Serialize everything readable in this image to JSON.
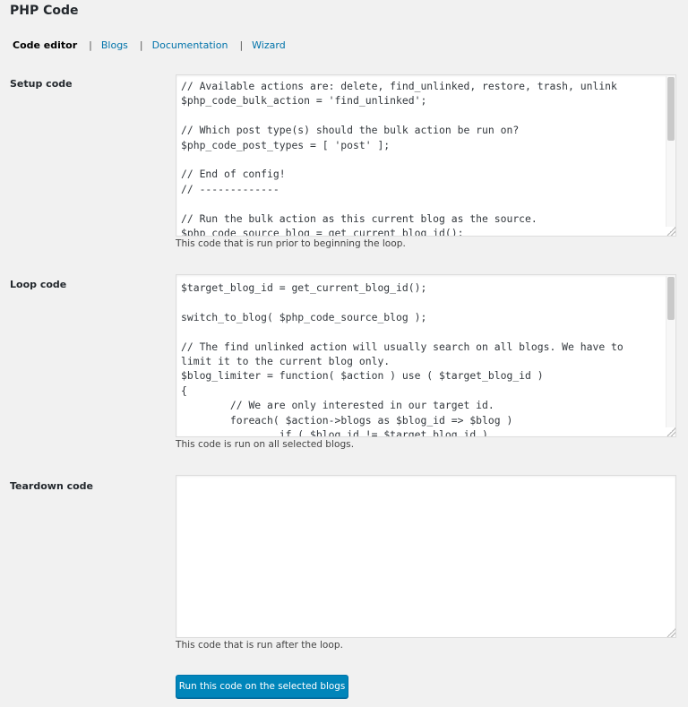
{
  "page": {
    "title": "PHP Code"
  },
  "subnav": {
    "items": [
      {
        "label": "Code editor"
      },
      {
        "label": "Blogs"
      },
      {
        "label": "Documentation"
      },
      {
        "label": "Wizard"
      }
    ],
    "separator": "|"
  },
  "setup": {
    "label": "Setup code",
    "code": "// Available actions are: delete, find_unlinked, restore, trash, unlink\n$php_code_bulk_action = 'find_unlinked';\n\n// Which post type(s) should the bulk action be run on?\n$php_code_post_types = [ 'post' ];\n\n// End of config!\n// -------------\n\n// Run the bulk action as this current blog as the source.\n$php_code_source_blog = get_current_blog_id();",
    "description": "This code that is run prior to beginning the loop."
  },
  "loop": {
    "label": "Loop code",
    "code": "$target_blog_id = get_current_blog_id();\n\nswitch_to_blog( $php_code_source_blog );\n\n// The find unlinked action will usually search on all blogs. We have to limit it to the current blog only.\n$blog_limiter = function( $action ) use ( $target_blog_id )\n{\n        // We are only interested in our target id.\n        foreach( $action->blogs as $blog_id => $blog )\n                if ( $blog_id != $target_blog_id )",
    "description": "This code is run on all selected blogs."
  },
  "teardown": {
    "label": "Teardown code",
    "code": "",
    "description": "This code that is run after the loop."
  },
  "submit": {
    "label": "Run this code on the selected blogs"
  },
  "colors": {
    "link": "#0073aa",
    "button": "#0085ba",
    "background": "#f1f1f1"
  }
}
